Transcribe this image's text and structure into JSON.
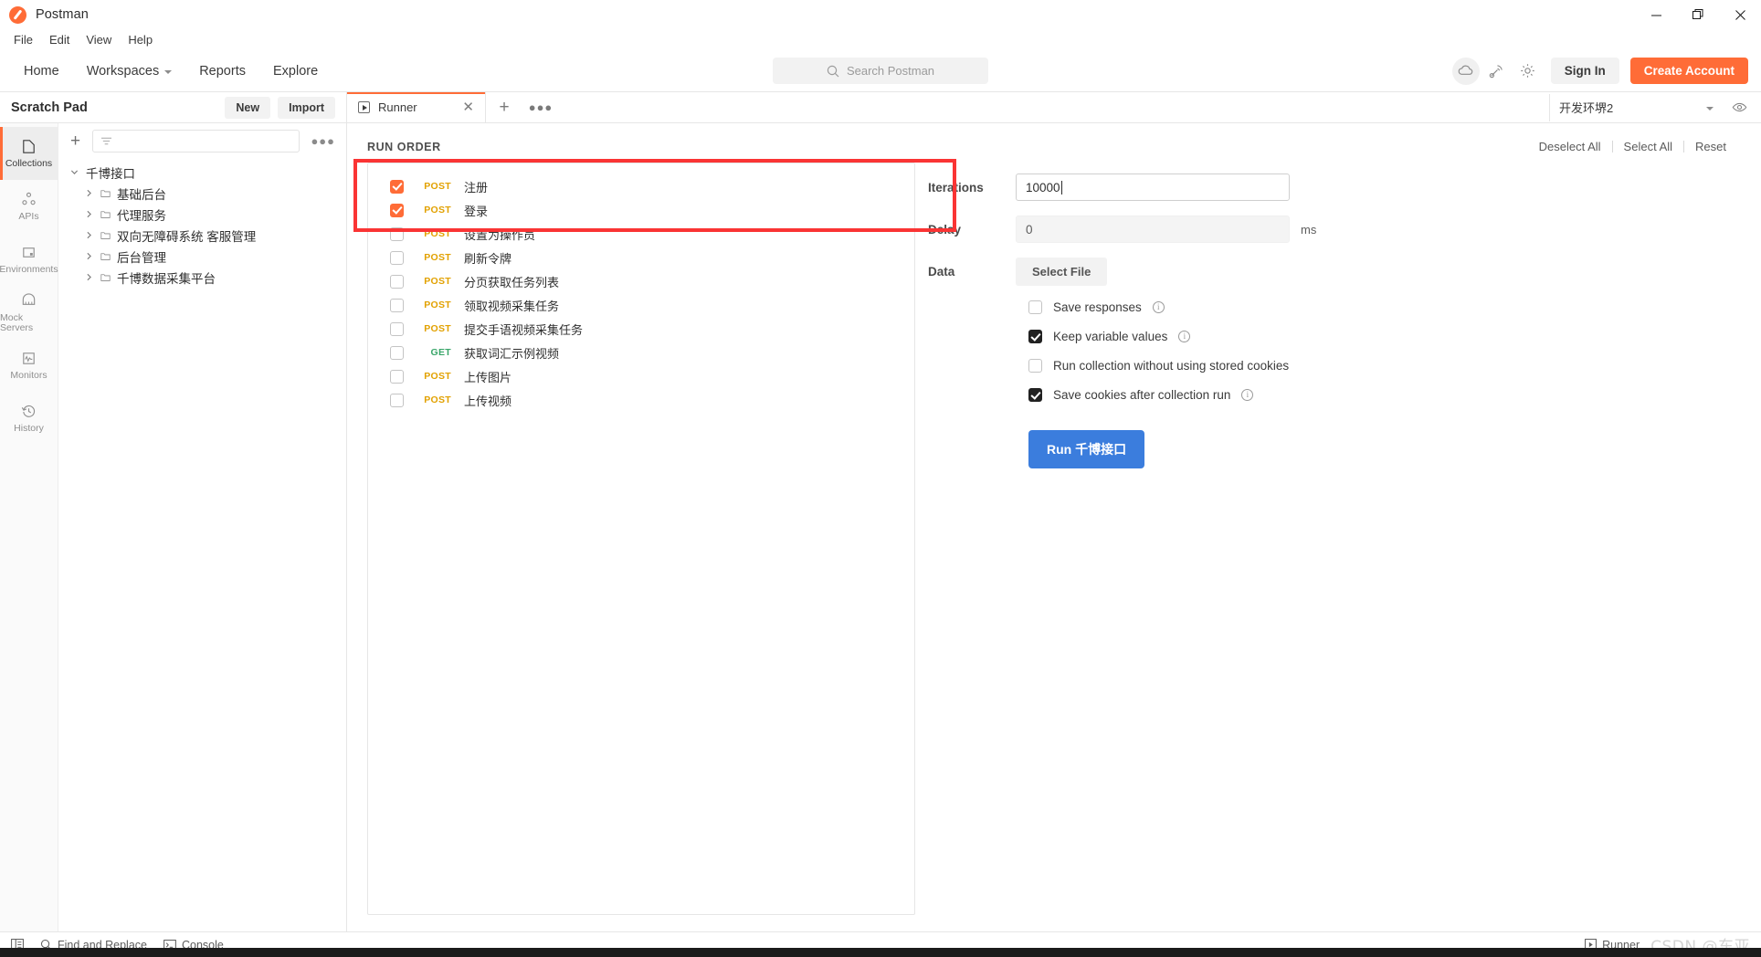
{
  "window": {
    "app_title": "Postman",
    "controls": {
      "minimize": "—",
      "maximize": "❐",
      "close": "✕"
    }
  },
  "menubar": {
    "items": [
      "File",
      "Edit",
      "View",
      "Help"
    ]
  },
  "navbar": {
    "items": [
      {
        "label": "Home",
        "has_caret": false
      },
      {
        "label": "Workspaces",
        "has_caret": true
      },
      {
        "label": "Reports",
        "has_caret": false
      },
      {
        "label": "Explore",
        "has_caret": false
      }
    ],
    "search_placeholder": "Search Postman",
    "sign_in_label": "Sign In",
    "create_account_label": "Create Account",
    "icons": [
      "cloud-offline-icon",
      "satellite-icon",
      "gear-icon"
    ]
  },
  "sidebar": {
    "title": "Scratch Pad",
    "new_label": "New",
    "import_label": "Import",
    "rail_items": [
      {
        "label": "Collections",
        "icon": "collections-icon",
        "active": true
      },
      {
        "label": "APIs",
        "icon": "apis-icon",
        "active": false
      },
      {
        "label": "Environments",
        "icon": "environments-icon",
        "active": false
      },
      {
        "label": "Mock Servers",
        "icon": "mock-servers-icon",
        "active": false
      },
      {
        "label": "Monitors",
        "icon": "monitors-icon",
        "active": false
      },
      {
        "label": "History",
        "icon": "history-icon",
        "active": false
      }
    ],
    "filter_placeholder": "",
    "tree": {
      "root": "千博接口",
      "children": [
        "基础后台",
        "代理服务",
        "双向无障碍系统 客服管理",
        "后台管理",
        "千博数据采集平台"
      ]
    }
  },
  "tabs": {
    "items": [
      {
        "label": "Runner",
        "icon": "runner-icon",
        "active": true
      }
    ],
    "add_label": "+",
    "more_label": "●●●",
    "environment": "开发环堺2"
  },
  "runner": {
    "section_title": "RUN ORDER",
    "actions": [
      "Deselect All",
      "Select All",
      "Reset"
    ],
    "requests": [
      {
        "method": "POST",
        "name": "注册",
        "checked": true
      },
      {
        "method": "POST",
        "name": "登录",
        "checked": true
      },
      {
        "method": "POST",
        "name": "设置为操作员",
        "checked": false
      },
      {
        "method": "POST",
        "name": "刷新令牌",
        "checked": false
      },
      {
        "method": "POST",
        "name": "分页获取任务列表",
        "checked": false
      },
      {
        "method": "POST",
        "name": "领取视频采集任务",
        "checked": false
      },
      {
        "method": "POST",
        "name": "提交手语视频采集任务",
        "checked": false
      },
      {
        "method": "GET",
        "name": "获取词汇示例视频",
        "checked": false
      },
      {
        "method": "POST",
        "name": "上传图片",
        "checked": false
      },
      {
        "method": "POST",
        "name": "上传视频",
        "checked": false
      }
    ],
    "settings": {
      "iterations_label": "Iterations",
      "iterations_value": "10000",
      "delay_label": "Delay",
      "delay_value": "0",
      "delay_unit": "ms",
      "data_label": "Data",
      "select_file_label": "Select File",
      "options": [
        {
          "label": "Save responses",
          "checked": false,
          "info": true
        },
        {
          "label": "Keep variable values",
          "checked": true,
          "info": true
        },
        {
          "label": "Run collection without using stored cookies",
          "checked": false,
          "info": false
        },
        {
          "label": "Save cookies after collection run",
          "checked": true,
          "info": true
        }
      ],
      "run_button_label": "Run 千博接口"
    }
  },
  "statusbar": {
    "left": [
      {
        "label": "",
        "icon": "sidebar-toggle-icon"
      },
      {
        "label": "Find and Replace",
        "icon": "search-icon"
      },
      {
        "label": "Console",
        "icon": "console-icon"
      }
    ],
    "right": {
      "runner_label": "Runner",
      "watermark": "CSDN @东亚"
    }
  },
  "colors": {
    "accent": "#ff6c37",
    "highlight": "#fa3434",
    "run_button": "#3b7ddd",
    "post_method": "#e2a100",
    "get_method": "#3aa66a"
  }
}
